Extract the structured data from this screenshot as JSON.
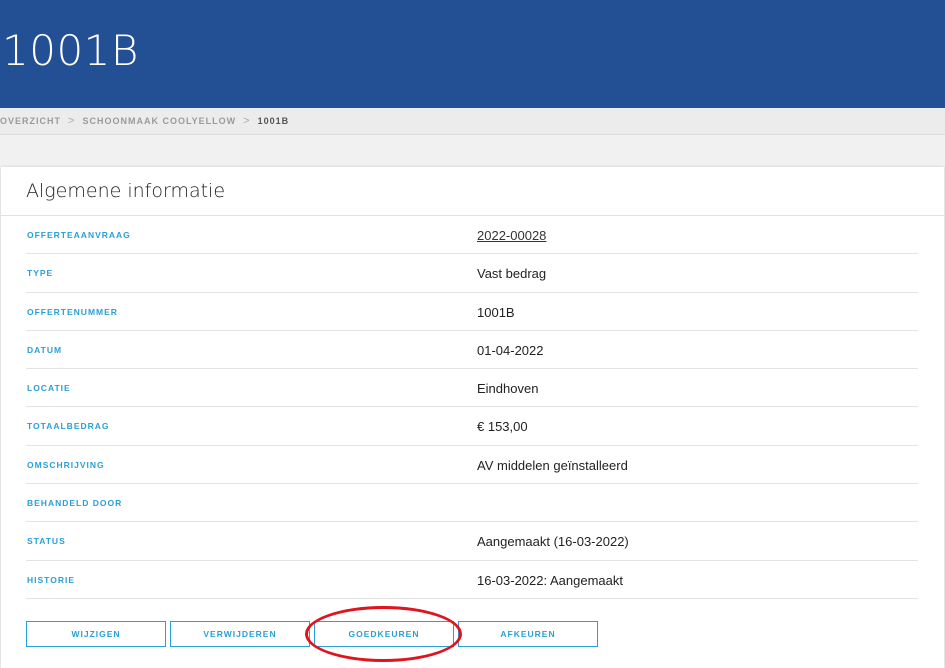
{
  "header": {
    "title": "1001B"
  },
  "breadcrumb": {
    "items": [
      "OVERZICHT",
      "SCHOONMAAK COOLYELLOW",
      "1001B"
    ],
    "separator": ">"
  },
  "card": {
    "title": "Algemene informatie",
    "rows": [
      {
        "label": "OFFERTEAANVRAAG",
        "value": "2022-00028"
      },
      {
        "label": "TYPE",
        "value": "Vast bedrag"
      },
      {
        "label": "OFFERTENUMMER",
        "value": "1001B"
      },
      {
        "label": "DATUM",
        "value": "01-04-2022"
      },
      {
        "label": "LOCATIE",
        "value": "Eindhoven"
      },
      {
        "label": "TOTAALBEDRAG",
        "value": "€ 153,00"
      },
      {
        "label": "OMSCHRIJVING",
        "value": "AV middelen geïnstalleerd"
      },
      {
        "label": "BEHANDELD DOOR",
        "value": ""
      },
      {
        "label": "STATUS",
        "value": "Aangemaakt (16-03-2022)"
      },
      {
        "label": "HISTORIE",
        "value": "16-03-2022: Aangemaakt"
      }
    ]
  },
  "actions": {
    "edit_label": "WIJZIGEN",
    "delete_label": "VERWIJDEREN",
    "approve_label": "GOEDKEUREN",
    "reject_label": "AFKEUREN"
  },
  "colors": {
    "header": "#234f95",
    "accent": "#2a9fd6",
    "highlight": "#e0141e"
  }
}
